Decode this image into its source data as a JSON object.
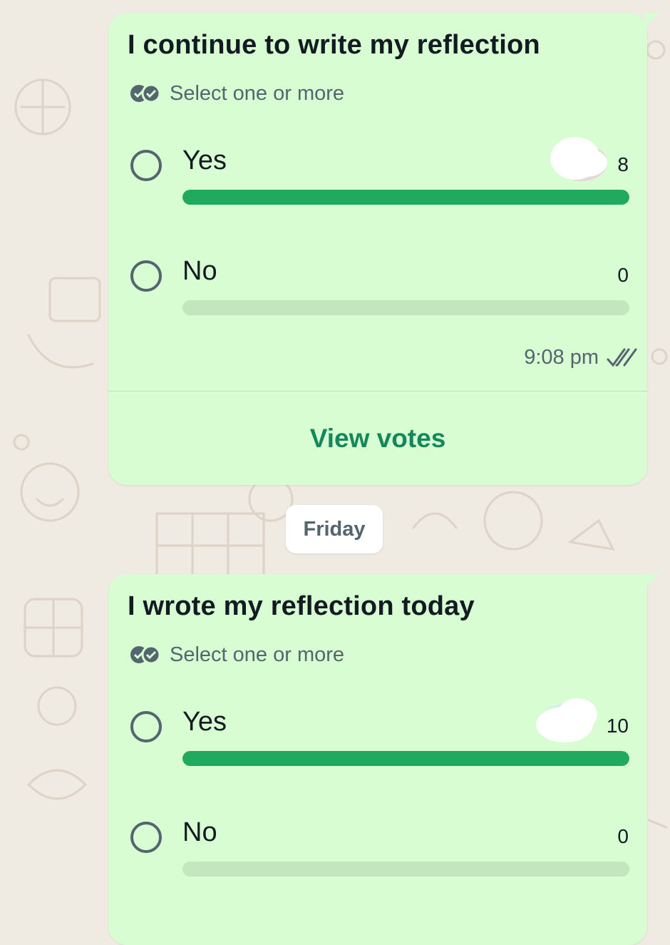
{
  "colors": {
    "bubble": "#d9fdd3",
    "bar_fill": "#21a95f",
    "bar_track": "#c3e6bf",
    "accent": "#15885b",
    "wallpaper": "#efeae2"
  },
  "polls": [
    {
      "question": "I continue to write my reflection",
      "hint": "Select one or more",
      "options": [
        {
          "label": "Yes",
          "count": "8",
          "fill_fraction": 1.0
        },
        {
          "label": "No",
          "count": "0",
          "fill_fraction": 0
        }
      ],
      "time": "9:08 pm",
      "status_icon": "double-check-icon",
      "view_votes": "View votes"
    },
    {
      "question": "I wrote my reflection today",
      "hint": "Select one or more",
      "options": [
        {
          "label": "Yes",
          "count": "10",
          "fill_fraction": 1.0
        },
        {
          "label": "No",
          "count": "0",
          "fill_fraction": 0
        }
      ]
    }
  ],
  "date_separator": "Friday"
}
